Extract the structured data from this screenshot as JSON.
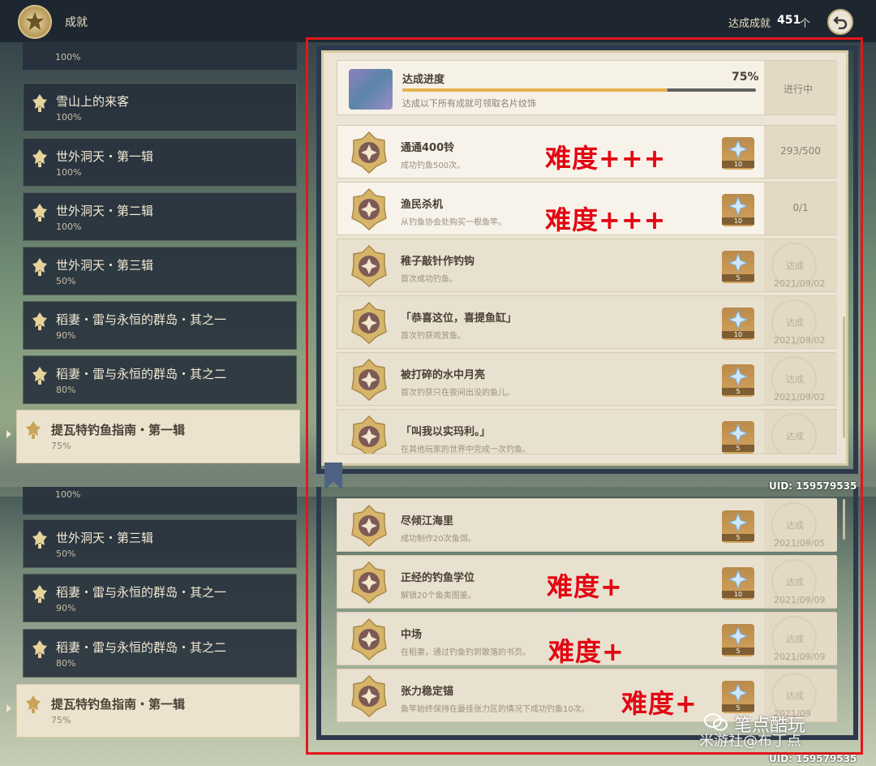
{
  "header": {
    "title": "成就",
    "count_label": "达成成就",
    "count_value": "451",
    "count_unit": "个"
  },
  "sidebar_top": [
    {
      "name": "",
      "pct": "100%"
    },
    {
      "name": "雪山上的来客",
      "pct": "100%"
    },
    {
      "name": "世外洞天・第一辑",
      "pct": "100%"
    },
    {
      "name": "世外洞天・第二辑",
      "pct": "100%"
    },
    {
      "name": "世外洞天・第三辑",
      "pct": "50%"
    },
    {
      "name": "稻妻・雷与永恒的群岛・其之一",
      "pct": "90%"
    },
    {
      "name": "稻妻・雷与永恒的群岛・其之二",
      "pct": "80%"
    },
    {
      "name": "提瓦特钓鱼指南・第一辑",
      "pct": "75%"
    }
  ],
  "sidebar_bottom": [
    {
      "name": "",
      "pct": "100%"
    },
    {
      "name": "世外洞天・第三辑",
      "pct": "50%"
    },
    {
      "name": "稻妻・雷与永恒的群岛・其之一",
      "pct": "90%"
    },
    {
      "name": "稻妻・雷与永恒的群岛・其之二",
      "pct": "80%"
    },
    {
      "name": "提瓦特钓鱼指南・第一辑",
      "pct": "75%"
    }
  ],
  "progress": {
    "title": "达成进度",
    "percent": "75%",
    "fraction": 0.75,
    "desc": "达成以下所有成就可领取名片纹饰",
    "status": "进行中"
  },
  "achievements_top": [
    {
      "name": "通通400铃",
      "desc": "成功钓鱼500次。",
      "reward": "10",
      "progress": "293/500",
      "done": false
    },
    {
      "name": "渔民杀机",
      "desc": "从钓鱼协会处购买一根鱼竿。",
      "reward": "10",
      "progress": "0/1",
      "done": false
    },
    {
      "name": "稚子敲针作钓钩",
      "desc": "首次成功钓鱼。",
      "reward": "5",
      "status": "达成",
      "date": "2021/09/02",
      "done": true
    },
    {
      "name": "「恭喜这位，喜提鱼缸」",
      "desc": "首次钓获观赏鱼。",
      "reward": "10",
      "status": "达成",
      "date": "2021/09/02",
      "done": true
    },
    {
      "name": "被打碎的水中月亮",
      "desc": "首次钓获只在夜间出没的鱼儿。",
      "reward": "5",
      "status": "达成",
      "date": "2021/09/02",
      "done": true
    },
    {
      "name": "「叫我以实玛利。」",
      "desc": "在其他玩家的世界中完成一次钓鱼。",
      "reward": "5",
      "status": "达成",
      "date": "",
      "done": true
    }
  ],
  "achievements_bottom": [
    {
      "name": "尽倾江海里",
      "desc": "成功制作20次鱼饵。",
      "reward": "5",
      "status": "达成",
      "date": "2021/09/05",
      "done": true
    },
    {
      "name": "正经的钓鱼学位",
      "desc": "解锁20个鱼类图鉴。",
      "reward": "10",
      "status": "达成",
      "date": "2021/09/09",
      "done": true
    },
    {
      "name": "中场",
      "desc": "在稻妻，通过钓鱼钓到散落的书页。",
      "reward": "5",
      "status": "达成",
      "date": "2021/09/09",
      "done": true
    },
    {
      "name": "张力稳定锚",
      "desc": "鱼竿始终保持在最佳张力区的情况下成功钓鱼10次。",
      "reward": "5",
      "status": "达成",
      "date": "2021/09",
      "done": true
    }
  ],
  "annotations": {
    "hard3": "难度+++",
    "hard1": "难度+"
  },
  "uid": "UID: 159579535",
  "watermark": {
    "line1": "笔点酷玩",
    "line2": "米游社@布丁点"
  },
  "colors": {
    "highlight_border": "#e4161b",
    "progress_fill": "#e7b24c",
    "annotation": "#e30613"
  }
}
